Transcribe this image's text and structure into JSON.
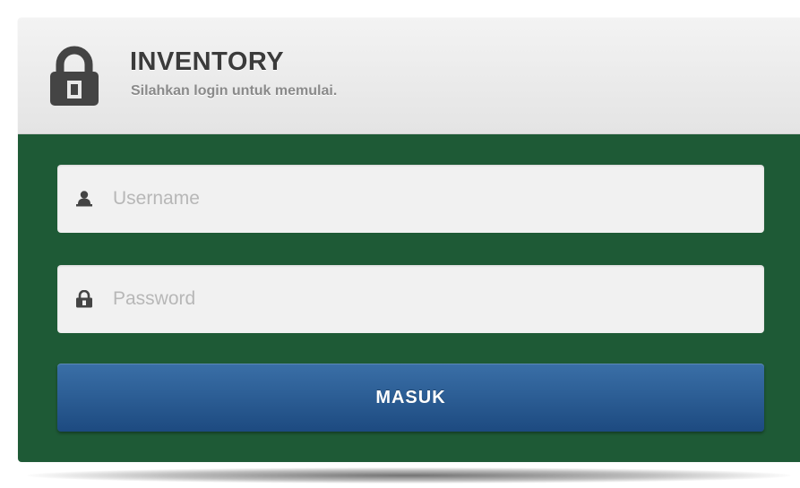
{
  "header": {
    "title": "INVENTORY",
    "subtitle": "Silahkan login untuk memulai.",
    "icon": "lock-icon"
  },
  "form": {
    "username": {
      "placeholder": "Username",
      "value": "",
      "icon": "user-icon"
    },
    "password": {
      "placeholder": "Password",
      "value": "",
      "icon": "lock-icon"
    },
    "submit_label": "MASUK"
  },
  "colors": {
    "header_bg": "#e8e8e8",
    "body_bg": "#1e5a36",
    "button_bg": "#2d5f96",
    "field_bg": "#f1f1f1",
    "title_text": "#3b3b3b",
    "subtitle_text": "#8a8a8a"
  }
}
